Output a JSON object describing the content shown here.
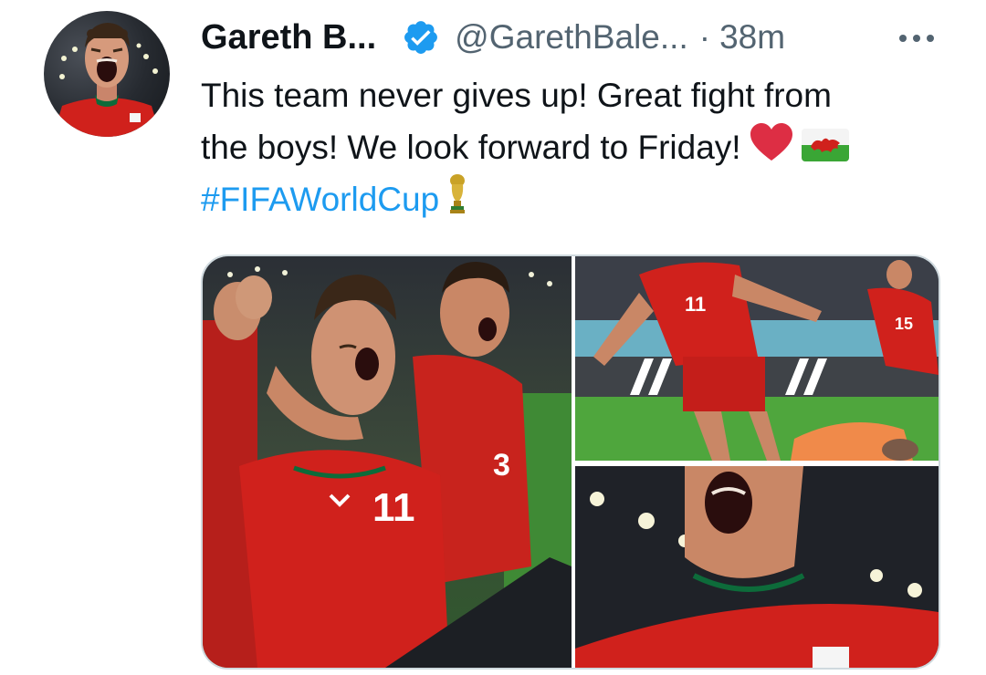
{
  "tweet": {
    "author_name": "Gareth B...",
    "author_handle": "@GarethBale...",
    "separator": "·",
    "timestamp": "38m",
    "verified_icon": "verified-badge-icon",
    "more_icon": "more-options-icon",
    "text_line_1": "This team never gives up! Great fight from",
    "text_line_2": "the boys! We look forward to Friday!",
    "hashtag": "#FIFAWorldCup",
    "emojis": [
      "red-heart-emoji",
      "wales-flag-emoji",
      "trophy-emoji"
    ],
    "media": [
      {
        "name": "photo-team-celebration",
        "alt_desc": "Wales players celebrating"
      },
      {
        "name": "photo-goal-celebration",
        "alt_desc": "Player running to celebrate"
      },
      {
        "name": "photo-bale-closeup",
        "alt_desc": "Close-up shouting"
      }
    ]
  },
  "colors": {
    "link_blue": "#1d9bf0",
    "text": "#0f1419",
    "secondary": "#536471",
    "border": "#cfd9de",
    "wales_red": "#d0211c"
  }
}
